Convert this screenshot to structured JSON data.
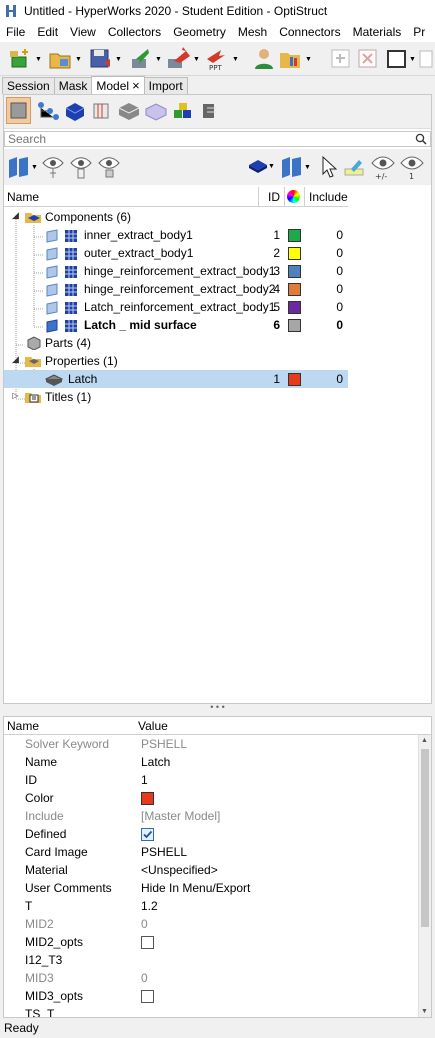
{
  "window": {
    "title": "Untitled - HyperWorks 2020 - Student Edition - OptiStruct"
  },
  "menu": [
    "File",
    "Edit",
    "View",
    "Collectors",
    "Geometry",
    "Mesh",
    "Connectors",
    "Materials",
    "Pr"
  ],
  "tabs": [
    {
      "label": "Session",
      "active": false
    },
    {
      "label": "Mask",
      "active": false
    },
    {
      "label": "Model",
      "active": true,
      "close": "×"
    },
    {
      "label": "Import",
      "active": false
    }
  ],
  "search": {
    "placeholder": "Search",
    "value": ""
  },
  "columns": {
    "name": "Name",
    "id": "ID",
    "include": "Include"
  },
  "tree": [
    {
      "label": "Components (6)",
      "level": 0,
      "kind": "folder-components",
      "expanded": true
    },
    {
      "label": "inner_extract_body1",
      "level": 1,
      "id": "1",
      "color": "#1faa4a",
      "include": "0"
    },
    {
      "label": "outer_extract_body1",
      "level": 1,
      "id": "2",
      "color": "#ffff00",
      "include": "0"
    },
    {
      "label": "hinge_reinforcement_extract_body1",
      "level": 1,
      "id": "3",
      "color": "#4f81bd",
      "include": "0"
    },
    {
      "label": "hinge_reinforcement_extract_body2",
      "level": 1,
      "id": "4",
      "color": "#e07b39",
      "include": "0"
    },
    {
      "label": "Latch_reinforcement_extract_body1",
      "level": 1,
      "id": "5",
      "color": "#6a2aa0",
      "include": "0"
    },
    {
      "label": "Latch _ mid surface",
      "level": 1,
      "id": "6",
      "color": "#a6a6a6",
      "include": "0",
      "bold": true
    },
    {
      "label": "Parts (4)",
      "level": 0,
      "kind": "folder-parts",
      "expanded": false
    },
    {
      "label": "Properties (1)",
      "level": 0,
      "kind": "folder-properties",
      "expanded": true
    },
    {
      "label": "Latch",
      "level": 1,
      "id": "1",
      "color": "#e8391d",
      "include": "0",
      "selected": true,
      "kind": "property"
    },
    {
      "label": "Titles (1)",
      "level": 0,
      "kind": "folder-titles",
      "expanded": false
    }
  ],
  "properties": {
    "header": {
      "name": "Name",
      "value": "Value"
    },
    "rows": [
      {
        "name": "Solver Keyword",
        "value": "PSHELL",
        "muted": true
      },
      {
        "name": "Name",
        "value": "Latch"
      },
      {
        "name": "ID",
        "value": "1"
      },
      {
        "name": "Color",
        "value": "",
        "swatch": "#e8391d"
      },
      {
        "name": "Include",
        "value": "[Master Model]",
        "muted": true
      },
      {
        "name": "Defined",
        "value": "",
        "checkbox": true,
        "checked": true
      },
      {
        "name": "Card Image",
        "value": "PSHELL"
      },
      {
        "name": "Material",
        "value": "<Unspecified>"
      },
      {
        "name": "User Comments",
        "value": "Hide In Menu/Export"
      },
      {
        "name": "T",
        "value": "1.2"
      },
      {
        "name": "MID2",
        "value": "0",
        "muted": true
      },
      {
        "name": "MID2_opts",
        "value": "",
        "checkbox": true,
        "checked": false
      },
      {
        "name": "I12_T3",
        "value": ""
      },
      {
        "name": "MID3",
        "value": "0",
        "muted": true
      },
      {
        "name": "MID3_opts",
        "value": "",
        "checkbox": true,
        "checked": false
      },
      {
        "name": "TS_T",
        "value": ""
      }
    ]
  },
  "status": {
    "text": "Ready"
  }
}
